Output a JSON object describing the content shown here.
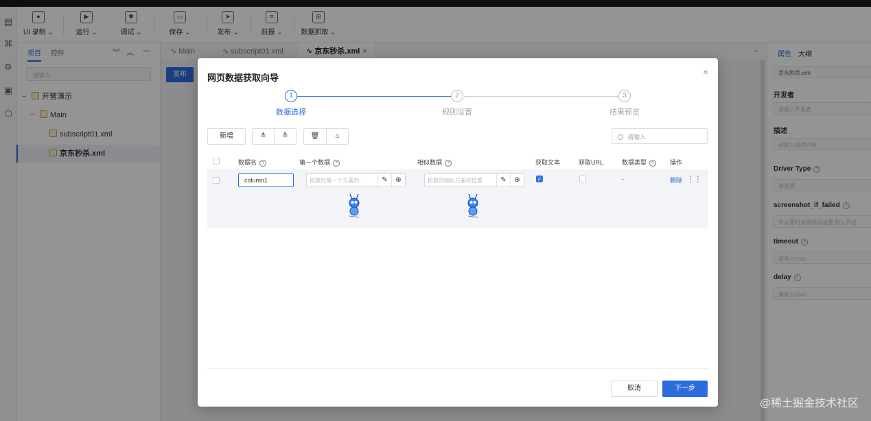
{
  "toolbar": {
    "items": [
      {
        "label": "UI 录制 ⌄",
        "icon": "record-icon"
      },
      {
        "label": "运行 ⌄",
        "icon": "play-icon"
      },
      {
        "label": "调试 ⌄",
        "icon": "debug-icon"
      },
      {
        "label": "保存 ⌄",
        "icon": "save-icon"
      },
      {
        "label": "发布 ⌄",
        "icon": "publish-icon"
      },
      {
        "label": "前报 ⌄",
        "icon": "report-icon"
      },
      {
        "label": "数据抓取 ⌄",
        "icon": "data-scrape-icon"
      }
    ]
  },
  "left_panel": {
    "tabs": [
      "项目",
      "控件"
    ],
    "search_placeholder": "请输入",
    "tree": [
      {
        "label": "开营演示",
        "toggle": "−"
      },
      {
        "label": "Main",
        "toggle": "−"
      },
      {
        "label": "subscript01.xml",
        "toggle": ""
      },
      {
        "label": "京东秒杀.xml",
        "toggle": ""
      }
    ]
  },
  "editor": {
    "tabs": [
      {
        "label": "Main"
      },
      {
        "label": "subscript01.xml"
      },
      {
        "label": "京东秒杀.xml",
        "close": "×"
      }
    ],
    "publish_label": "发布"
  },
  "right_panel": {
    "tabs": [
      "属性",
      "大纲"
    ],
    "name_value": "京东秒杀.xml",
    "fields": [
      {
        "label": "开发者",
        "placeholder": "请输入开发者"
      },
      {
        "label": "描述",
        "placeholder": "请输入描述内容"
      },
      {
        "label": "Driver Type",
        "placeholder": "请选择"
      },
      {
        "label": "screenshot_if_failed",
        "placeholder": "不设置时读取项目设置,默认开启"
      },
      {
        "label": "timeout",
        "placeholder": "请输入(ms)"
      },
      {
        "label": "delay",
        "placeholder": "请输入(ms)"
      }
    ]
  },
  "modal": {
    "title": "网页数据获取向导",
    "close": "×",
    "steps": [
      {
        "num": "1",
        "label": "数据选择"
      },
      {
        "num": "2",
        "label": "规则设置"
      },
      {
        "num": "3",
        "label": "结果预览"
      }
    ],
    "toolbar": {
      "add_label": "新增",
      "search_placeholder": "请输入"
    },
    "columns": [
      "数据名",
      "第一个数据",
      "相似数据",
      "获取文本",
      "获取URL",
      "数据类型",
      "操作"
    ],
    "row": {
      "name": "column1",
      "first_placeholder": "抓取的第一个元素的...",
      "similar_placeholder": "抓取的相似元素的位置",
      "get_text": true,
      "get_url": false,
      "data_type": "-",
      "delete_label": "删除"
    },
    "cancel_label": "取消",
    "next_label": "下一步"
  },
  "watermark": "@稀土掘金技术社区",
  "colors": {
    "accent": "#2d6cdf"
  }
}
